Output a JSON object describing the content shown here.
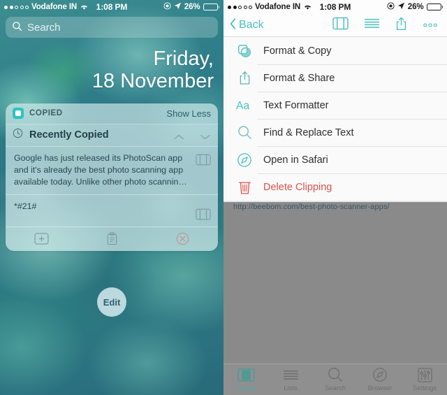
{
  "status_bar": {
    "carrier": "Vodafone IN",
    "signal_filled_dots": 2,
    "signal_empty_dots": 3,
    "wifi_icon": "wifi-icon",
    "time": "1:08 PM",
    "alarm_icon": "do-not-disturb-icon",
    "location_icon": "location-arrow-icon",
    "battery_percent": "26%",
    "battery_level": 26
  },
  "left_screen": {
    "search": {
      "placeholder": "Search",
      "icon": "search-icon"
    },
    "date": {
      "weekday": "Friday,",
      "day_month": "18 November"
    },
    "widget": {
      "app_icon": "copied-app-icon",
      "title": "COPIED",
      "show_toggle": "Show Less",
      "section": {
        "icon": "clock-icon",
        "label": "Recently Copied",
        "up_icon": "chevron-up-icon",
        "down_icon": "chevron-down-icon"
      },
      "clippings": [
        {
          "text": "Google has just released its PhotoScan app and it's already the best photo scanning app available today. Unlike other photo scannin…",
          "action_icon": "clipping-card-icon"
        },
        {
          "text": "*#21#",
          "action_icon": "clipping-card-icon"
        }
      ],
      "footer": [
        {
          "name": "add-clipping-button",
          "icon": "plus-square-icon"
        },
        {
          "name": "clipboard-button",
          "icon": "clipboard-icon"
        },
        {
          "name": "clear-button",
          "icon": "x-circle-icon"
        }
      ]
    },
    "edit_button": "Edit"
  },
  "right_screen": {
    "nav": {
      "back_label": "Back",
      "back_icon": "chevron-left-icon",
      "icons": [
        {
          "name": "clipping-card-icon",
          "label": "Clipping"
        },
        {
          "name": "list-lines-icon",
          "label": "Lists"
        },
        {
          "name": "share-icon",
          "label": "Share"
        },
        {
          "name": "more-dots-icon",
          "label": "More"
        }
      ]
    },
    "menu_items": [
      {
        "label": "Format & Copy",
        "icon": "format-copy-icon",
        "danger": false
      },
      {
        "label": "Format & Share",
        "icon": "share-icon",
        "danger": false
      },
      {
        "label": "Text Formatter",
        "icon": "text-aa-icon",
        "danger": false
      },
      {
        "label": "Find & Replace Text",
        "icon": "search-icon",
        "danger": false
      },
      {
        "label": "Open in Safari",
        "icon": "safari-compass-icon",
        "danger": false
      },
      {
        "label": "Delete Clipping",
        "icon": "trash-icon",
        "danger": true
      }
    ],
    "background_url": "http://beebom.com/best-photo-scanner-apps/",
    "tabs": [
      {
        "label": "Copied",
        "icon": "clipping-card-icon",
        "active": true
      },
      {
        "label": "Lists",
        "icon": "list-lines-icon",
        "active": false
      },
      {
        "label": "Search",
        "icon": "search-icon",
        "active": false
      },
      {
        "label": "Browser",
        "icon": "safari-compass-icon",
        "active": false
      },
      {
        "label": "Settings",
        "icon": "sliders-icon",
        "active": false
      }
    ]
  },
  "colors": {
    "accent_teal": "#4bbfbf",
    "danger_red": "#d9534f",
    "tab_active": "#5aa7a3",
    "wallpaper_base": "#2f7f8a"
  }
}
